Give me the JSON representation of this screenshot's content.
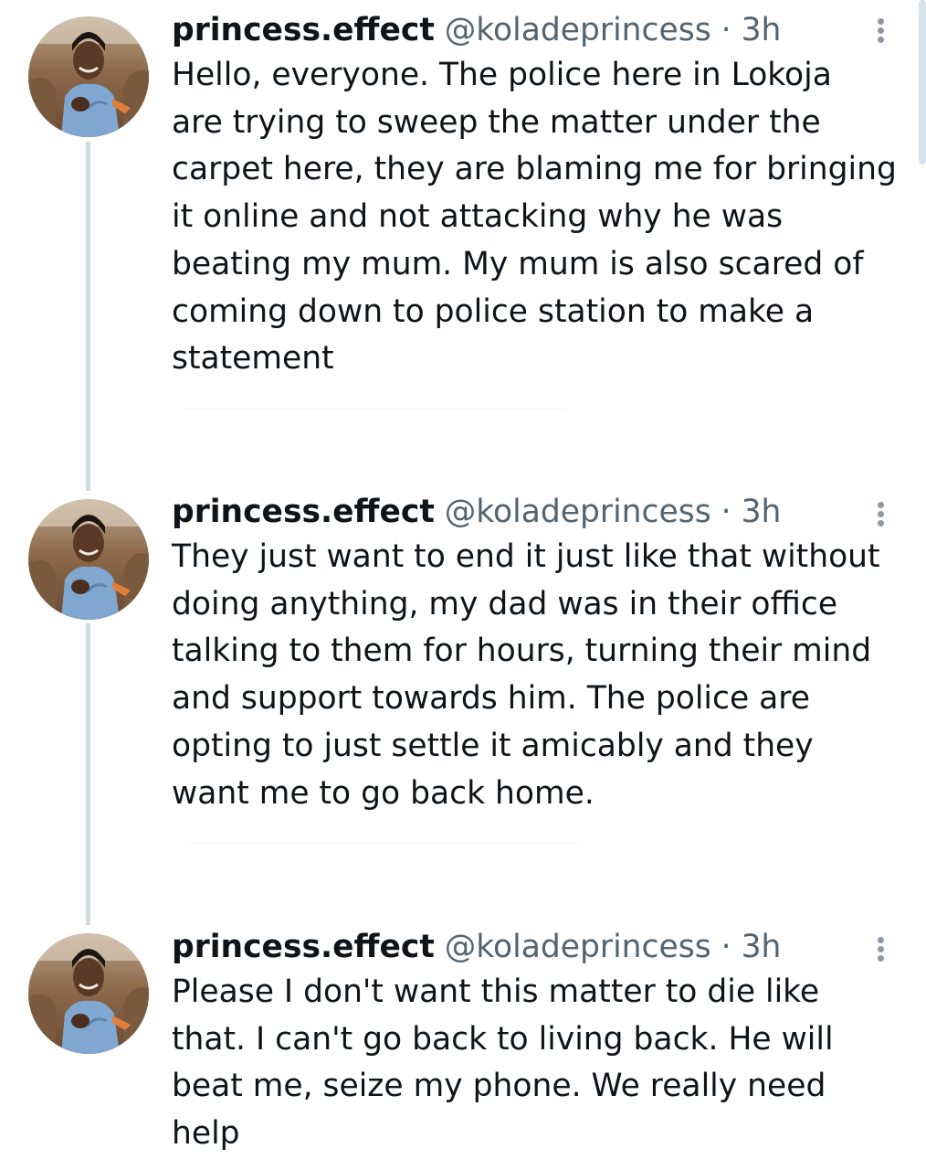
{
  "thread": {
    "tweets": [
      {
        "author_name": "princess.effect",
        "handle": "@koladeprincess",
        "separator": "·",
        "time": "3h",
        "more_icon": "more-vertical-icon",
        "text_lines": [
          "Hello, everyone. The police here in Lokoja",
          "are trying to sweep the matter under the",
          "carpet here, they are blaming me for bringing",
          "it online and not attacking why he was",
          "beating my mum. My mum is also scared of",
          "coming down to police station to make a",
          "statement"
        ]
      },
      {
        "author_name": "princess.effect",
        "handle": "@koladeprincess",
        "separator": "·",
        "time": "3h",
        "more_icon": "more-vertical-icon",
        "text_lines": [
          "They just want to end it just like that without",
          "doing anything, my dad was in their office",
          "talking to them for hours, turning their mind",
          "and support towards him. The police are",
          "opting to just settle it amicably and they",
          "want me to go back home."
        ]
      },
      {
        "author_name": "princess.effect",
        "handle": "@koladeprincess",
        "separator": "·",
        "time": "3h",
        "more_icon": "more-vertical-icon",
        "text_lines": [
          "Please I don't want this matter to die like",
          "that. I can't go back to living back. He will",
          "beat me, seize my phone. We really need",
          "help"
        ]
      }
    ]
  },
  "colors": {
    "text_primary": "#0f1419",
    "text_secondary": "#536471",
    "thread_line": "#cfd9de",
    "more_dots": "#8b98a5",
    "scrollbar": "#d5e3ef"
  }
}
